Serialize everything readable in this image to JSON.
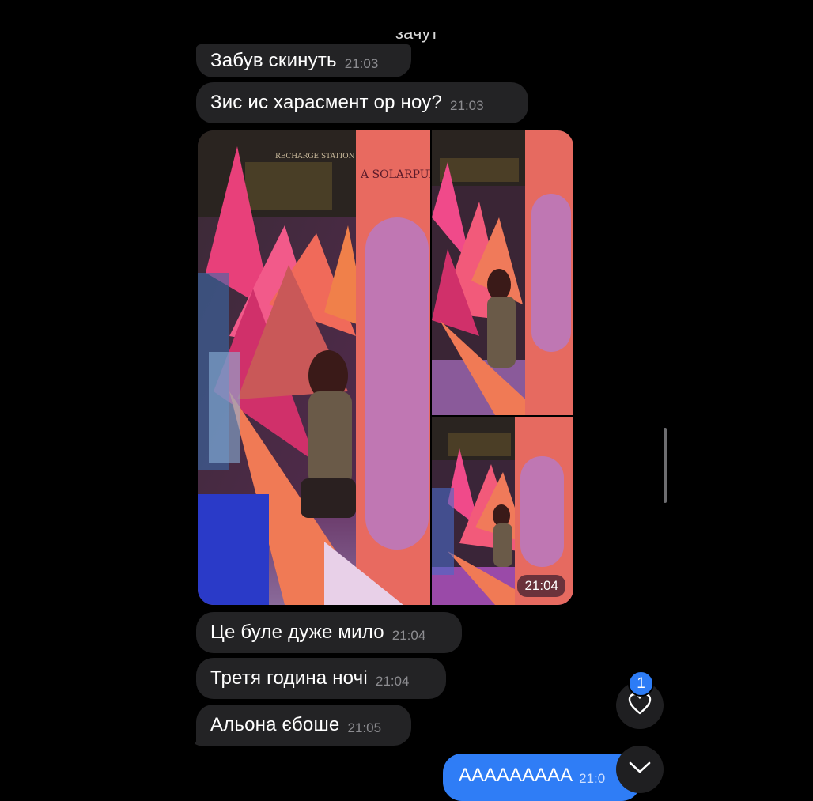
{
  "chat": {
    "cut_top_text": "зачут",
    "messages": [
      {
        "text": "Забув скинуть",
        "time": "21:03"
      },
      {
        "text": "Зис ис харасмент ор ноу?",
        "time": "21:03"
      },
      {
        "text": "Це буле дуже мило",
        "time": "21:04"
      },
      {
        "text": "Третя година ночі",
        "time": "21:04"
      },
      {
        "text": "Альона єбоше",
        "time": "21:05"
      }
    ],
    "gallery": {
      "time": "21:04",
      "photo_sign_text": "A SOLARPUNK EXPERIENCE",
      "station_text": "RECHARGE STATION",
      "photo_count": 3
    },
    "outgoing": {
      "text": "АААААААAА",
      "time": "21:0"
    }
  },
  "controls": {
    "reaction_count": "1",
    "heart_icon": "heart-icon",
    "scroll_down_icon": "chevron-down-icon"
  },
  "colors": {
    "background": "#000000",
    "incoming_bubble": "#232325",
    "outgoing_bubble": "#2f7df6",
    "badge": "#2d7cf6"
  }
}
